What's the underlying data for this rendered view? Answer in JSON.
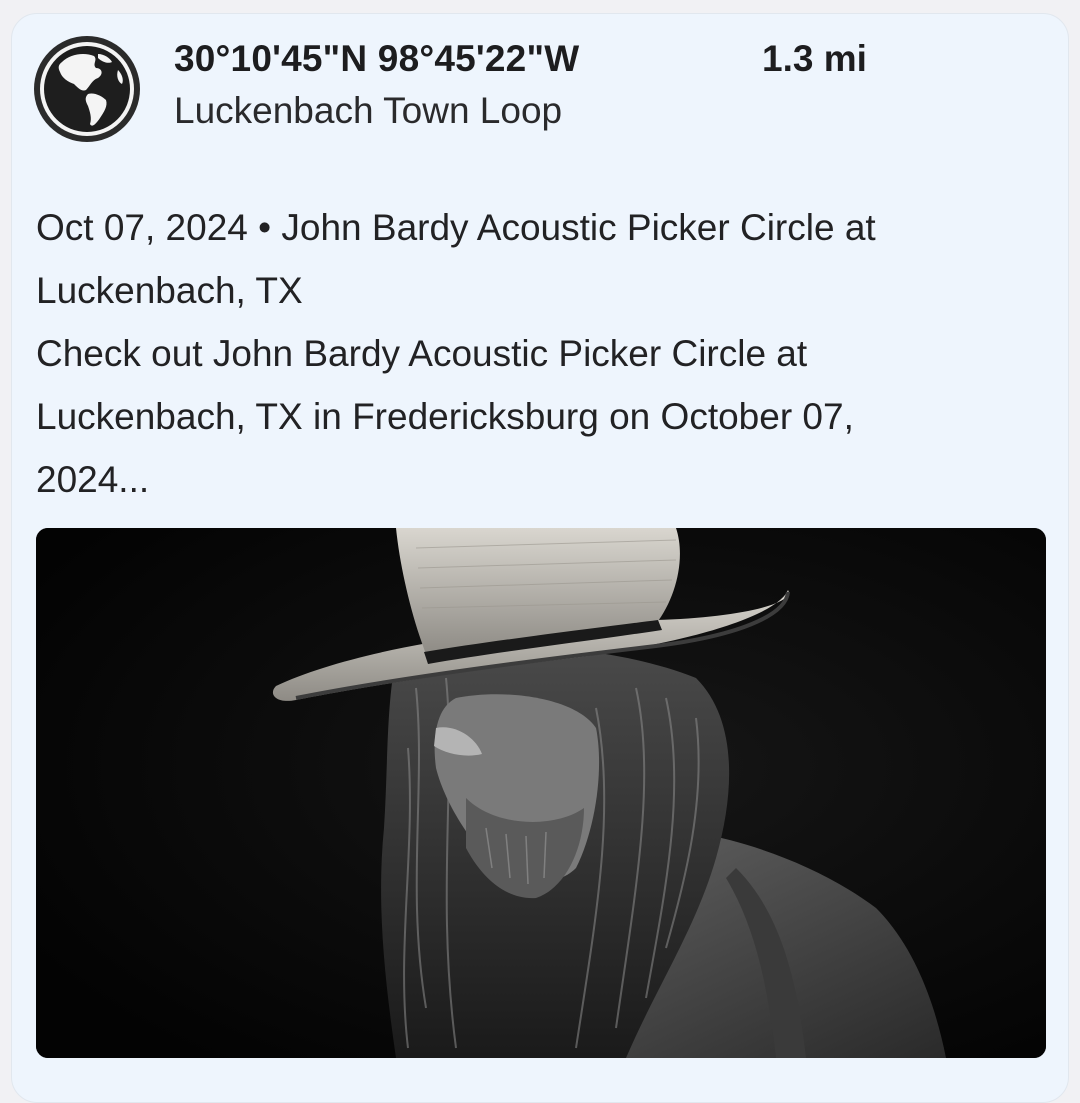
{
  "post": {
    "coordinates": "30°10'45\"N 98°45'22\"W",
    "distance": "1.3 mi",
    "location_name": "Luckenbach Town Loop",
    "headline_line1": "Oct 07, 2024 • John Bardy Acoustic Picker Circle at",
    "headline_line2": "Luckenbach, TX",
    "snippet_line1": "Check out John Bardy Acoustic Picker Circle at",
    "snippet_line2": "Luckenbach, TX in Fredericksburg on October 07,",
    "snippet_line3": "2024...",
    "avatar_icon": "globe-americas-icon",
    "image_subject": "black-and-white photo of a long-haired man in a straw cowboy hat"
  },
  "colors": {
    "card_background": "#eef5fd",
    "page_background": "#f1f1f4",
    "text_primary": "#1d1d1f"
  }
}
